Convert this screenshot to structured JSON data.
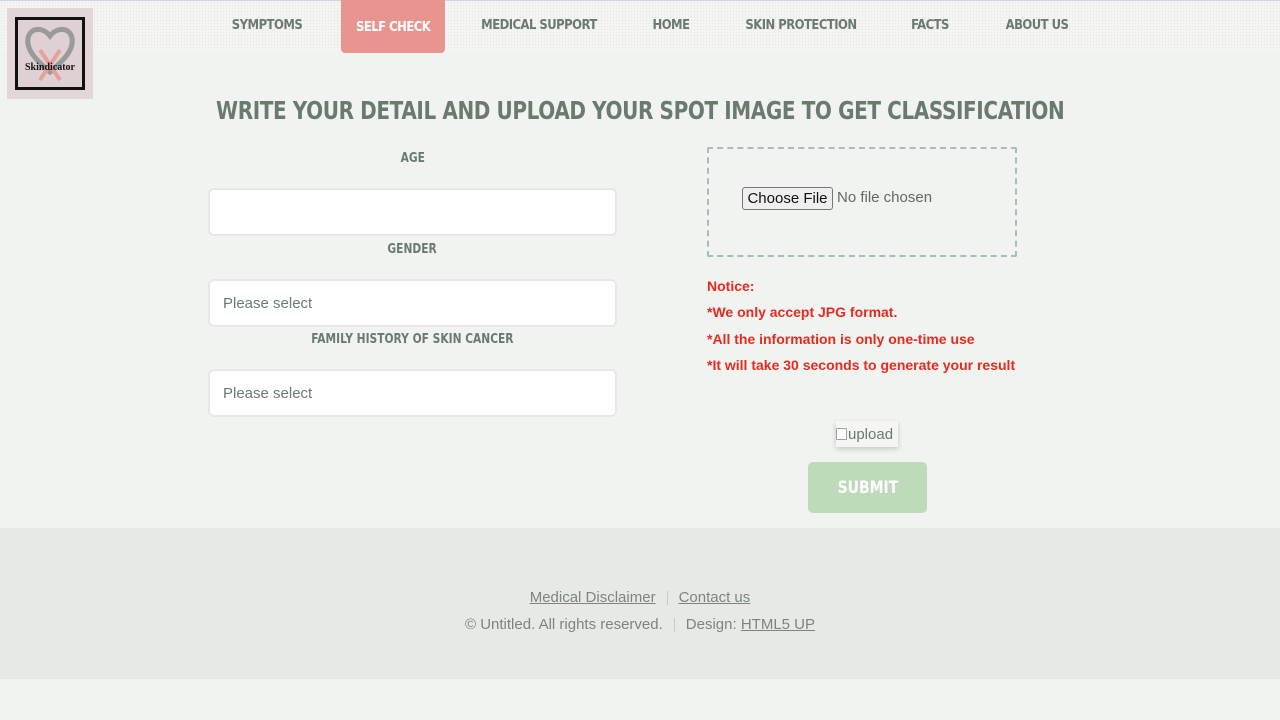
{
  "logo": {
    "text": "Skindicator"
  },
  "nav": {
    "items": [
      {
        "label": "SYMPTOMS"
      },
      {
        "label": "SELF CHECK"
      },
      {
        "label": "MEDICAL SUPPORT"
      },
      {
        "label": "HOME"
      },
      {
        "label": "SKIN PROTECTION"
      },
      {
        "label": "FACTS"
      },
      {
        "label": "ABOUT US"
      }
    ],
    "active": "SELF CHECK"
  },
  "page": {
    "heading": "WRITE YOUR DETAIL AND UPLOAD YOUR SPOT IMAGE TO GET CLASSIFICATION"
  },
  "form": {
    "age": {
      "label": "AGE",
      "value": ""
    },
    "gender": {
      "label": "GENDER",
      "value": "Please select"
    },
    "family_history": {
      "label": "FAMILY HISTORY OF SKIN CANCER",
      "value": "Please select"
    }
  },
  "upload": {
    "button_label": "Choose File",
    "status": "No file chosen"
  },
  "notice": {
    "title": "Notice:",
    "lines": [
      "*We only accept JPG format.",
      "*All the information is only one-time use",
      "*It will take 30 seconds to generate your result"
    ]
  },
  "upload_image": {
    "alt": "upload"
  },
  "submit": {
    "label": "SUBMIT"
  },
  "footer": {
    "links": [
      "Medical Disclaimer",
      "Contact us"
    ],
    "copyright": "© Untitled. All rights reserved.",
    "design_prefix": "Design:",
    "design_link": "HTML5 UP"
  },
  "colors": {
    "accent": "#e8958f",
    "text": "#6b7a6f",
    "notice": "#e52b1f",
    "submit": "#bddbb9",
    "background": "#f1f3f0",
    "footer_bg": "#e7e9e6"
  }
}
